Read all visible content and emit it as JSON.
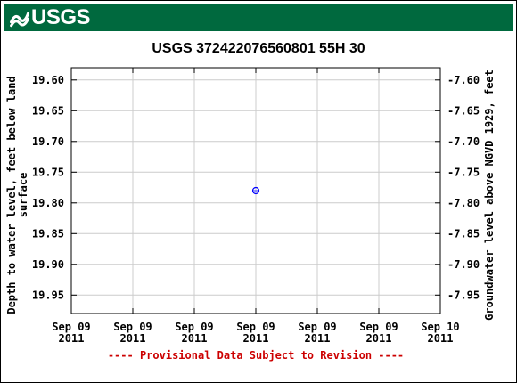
{
  "banner": {
    "logo_text": "USGS"
  },
  "chart_data": {
    "type": "scatter",
    "title": "USGS 372422076560801 55H 30",
    "ylabel_left": [
      "Depth to water level, feet below land",
      "surface"
    ],
    "ylabel_right": "Groundwater level above NGVD 1929, feet",
    "ylim_left": [
      19.98,
      19.58
    ],
    "ylim_right": [
      -7.58,
      -7.98
    ],
    "yticks_left": [
      "19.60",
      "19.65",
      "19.70",
      "19.75",
      "19.80",
      "19.85",
      "19.90",
      "19.95"
    ],
    "yticks_left_values": [
      19.6,
      19.65,
      19.7,
      19.75,
      19.8,
      19.85,
      19.9,
      19.95
    ],
    "yticks_right": [
      "-7.60",
      "-7.65",
      "-7.70",
      "-7.75",
      "-7.80",
      "-7.85",
      "-7.90",
      "-7.95"
    ],
    "xticks": [
      {
        "line1": "Sep 09",
        "line2": "2011"
      },
      {
        "line1": "Sep 09",
        "line2": "2011"
      },
      {
        "line1": "Sep 09",
        "line2": "2011"
      },
      {
        "line1": "Sep 09",
        "line2": "2011"
      },
      {
        "line1": "Sep 09",
        "line2": "2011"
      },
      {
        "line1": "Sep 09",
        "line2": "2011"
      },
      {
        "line1": "Sep 10",
        "line2": "2011"
      }
    ],
    "points": [
      {
        "x_tick_fraction": 0.5,
        "y": 19.78
      }
    ],
    "point_color": "#0000ff",
    "grid": true,
    "footnote": "---- Provisional Data Subject to Revision ----",
    "footnote_color": "#cc0000"
  }
}
